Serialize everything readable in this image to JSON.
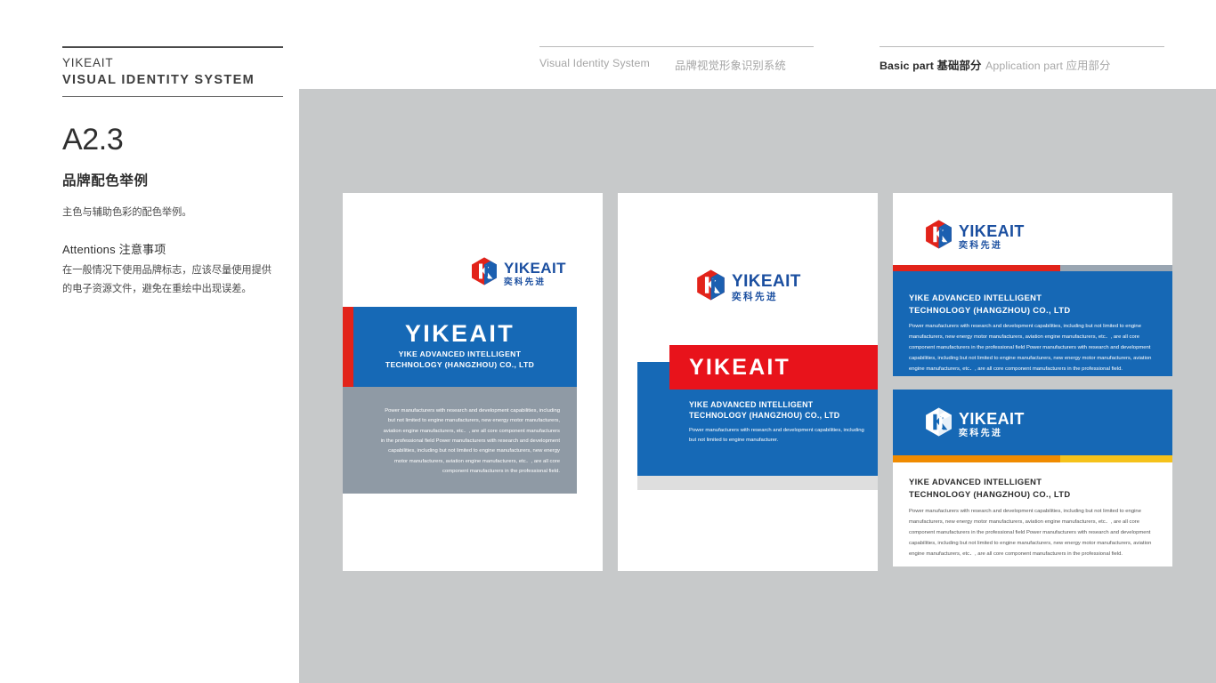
{
  "brand": {
    "name": "YIKEAIT",
    "subtitle": "VISUAL IDENTITY SYSTEM"
  },
  "header": {
    "left_group": {
      "label_en": "Visual Identity System",
      "label_cn": "品牌视觉形象识别系统"
    },
    "right_group": {
      "basic_part_en": "Basic part",
      "basic_part_cn": "基础部分",
      "application_part_en": "Application part",
      "application_part_cn": "应用部分"
    }
  },
  "sidebar": {
    "section_number": "A2.3",
    "section_title": "品牌配色举例",
    "section_desc": "主色与辅助色彩的配色举例。",
    "attentions_en": "Attentions",
    "attentions_cn": "注意事项",
    "attentions_body": "在一般情况下使用品牌标志，应该尽量使用提供的电子资源文件，避免在重绘中出现误差。"
  },
  "logo": {
    "wordmark": "YIKEAIT",
    "chinese": "奕科先进",
    "mark_red": "#e2231a",
    "mark_blue": "#1b5fb0",
    "word_blue": "#1b4fa0"
  },
  "colors": {
    "canvas_gray": "#c7c9ca",
    "primary_blue": "#1668b5",
    "primary_red": "#e2231a",
    "accent_slate": "#8f9aa5",
    "accent_orange": "#f08b00",
    "accent_gold": "#f5c21b",
    "light_gray": "#dedede"
  },
  "company": {
    "name_line1": "YIKE ADVANCED INTELLIGENT",
    "name_line2": "TECHNOLOGY (HANGZHOU) CO., LTD",
    "brandmark": "YIKEAIT",
    "paragraph_long": "Power manufacturers with research and development capabilities, including but not limited to engine manufacturers, new energy motor manufacturers, aviation engine manufacturers, etc．, are all core component manufacturers in the professional field Power manufacturers with research and development capabilities, including but not limited to engine manufacturers, new energy motor manufacturers, aviation engine manufacturers, etc．, are all core component manufacturers in the professional field.",
    "paragraph_short": "Power manufacturers with research and development capabilities, including but not limited to engine manufacturer."
  }
}
